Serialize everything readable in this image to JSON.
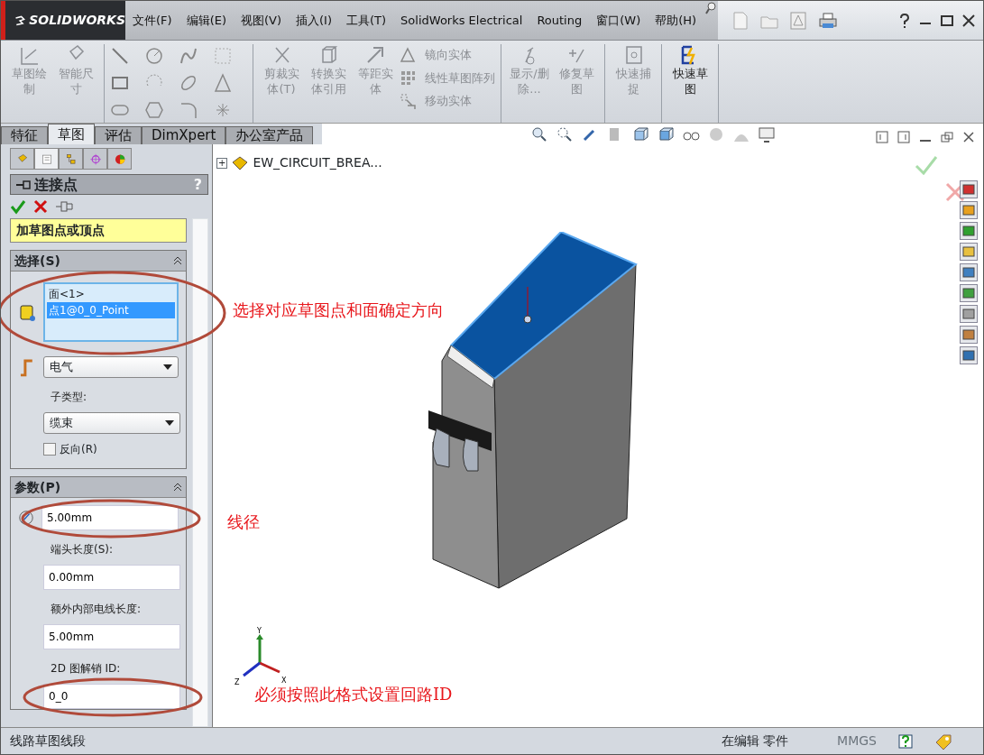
{
  "logo": "SOLIDWORKS",
  "menu": [
    "文件(F)",
    "编辑(E)",
    "视图(V)",
    "插入(I)",
    "工具(T)",
    "SolidWorks Electrical",
    "Routing",
    "窗口(W)",
    "帮助(H)"
  ],
  "ribbon": [
    {
      "kind": "buttons",
      "items": [
        {
          "kind": "big",
          "label": "草图绘制",
          "disabled": true
        },
        {
          "kind": "big",
          "label": "智能尺寸",
          "disabled": true
        }
      ]
    },
    {
      "kind": "sketch-tools"
    },
    {
      "kind": "buttons",
      "items": [
        {
          "kind": "big",
          "label": "剪裁实体(T)",
          "disabled": true
        },
        {
          "kind": "big",
          "label": "转换实体引用",
          "disabled": true
        },
        {
          "kind": "big",
          "label": "等距实体",
          "disabled": true
        },
        {
          "kind": "small",
          "label": "镜向实体",
          "disabled": true
        },
        {
          "kind": "small",
          "label": "线性草图阵列",
          "disabled": true
        },
        {
          "kind": "small",
          "label": "移动实体",
          "disabled": true
        }
      ]
    },
    {
      "kind": "buttons",
      "items": [
        {
          "kind": "big",
          "label": "显示/删除...",
          "disabled": true
        },
        {
          "kind": "big",
          "label": "修复草图",
          "disabled": true
        }
      ]
    },
    {
      "kind": "buttons",
      "items": [
        {
          "kind": "big",
          "label": "快速捕捉",
          "disabled": true
        }
      ]
    },
    {
      "kind": "buttons",
      "items": [
        {
          "kind": "big",
          "label": "快速草图",
          "disabled": false
        }
      ]
    }
  ],
  "tabs": [
    {
      "label": "特征",
      "selected": false
    },
    {
      "label": "草图",
      "selected": true
    },
    {
      "label": "评估",
      "selected": false
    },
    {
      "label": "DimXpert",
      "selected": false
    },
    {
      "label": "办公室产品",
      "selected": false
    }
  ],
  "panel_tabs": [
    {
      "selected": false
    },
    {
      "selected": true
    },
    {
      "selected": false
    },
    {
      "selected": false
    },
    {
      "selected": false
    }
  ],
  "property_manager": {
    "title": "连接点",
    "help": "?",
    "message": "加草图点或顶点",
    "selection": {
      "title": "选择(S)",
      "items": [
        {
          "text": "面<1>",
          "selected": false
        },
        {
          "text": "点1@0_0_Point",
          "selected": true
        }
      ],
      "type": "电气",
      "subtype_label": "子类型:",
      "subtype": "缆束",
      "reverse": {
        "label": "反向(R)",
        "checked": false
      }
    },
    "parameters": {
      "title": "参数(P)",
      "diameter": "5.00mm",
      "fields": [
        {
          "label": "端头长度(S):",
          "value": "0.00mm"
        },
        {
          "label": "额外内部电线长度:",
          "value": "5.00mm"
        },
        {
          "label": "2D 图解销 ID:",
          "value": "0_0"
        }
      ]
    }
  },
  "tree": {
    "expander": "+",
    "label": "EW_CIRCUIT_BREA..."
  },
  "axis_labels": [
    "Y",
    "X",
    "Z"
  ],
  "annotations": [
    "选择对应草图点和面确定方向",
    "线径",
    "必须按照此格式设置回路ID"
  ],
  "status_bar": {
    "hint": "线路草图线段",
    "mode": "在编辑 零件",
    "units": "MMGS"
  }
}
